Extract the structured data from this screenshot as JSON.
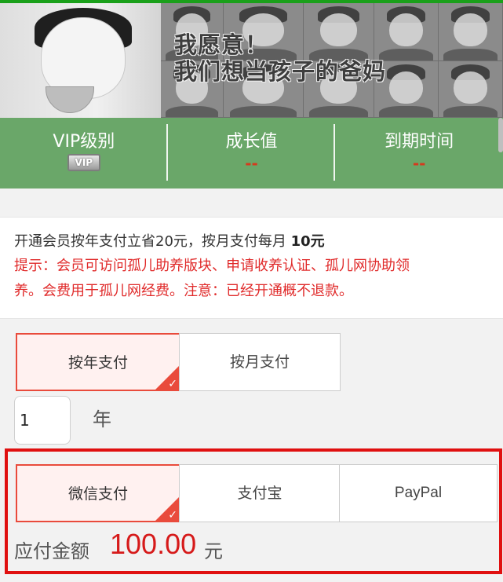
{
  "banner": {
    "slogan_line1": "我愿意！",
    "slogan_line2": "我们想当孩子的爸妈"
  },
  "stats": [
    {
      "label": "VIP级别",
      "badge": "VIP"
    },
    {
      "label": "成长值",
      "value": "--"
    },
    {
      "label": "到期时间",
      "value": "--"
    }
  ],
  "notice": {
    "line1": "开通会员按年支付立省20元，按月支付每月 ",
    "line1_price": "10元",
    "tip_line1": "提示：会员可访问孤儿助养版块、申请收养认证、孤儿网协助领",
    "tip_line2": "养。会费用于孤儿网经费。注意：已经开通概不退款。"
  },
  "billing": {
    "options": [
      "按年支付",
      "按月支付"
    ],
    "selected": "按年支付",
    "quantity": "1",
    "unit": "年"
  },
  "payment": {
    "methods": [
      "微信支付",
      "支付宝",
      "PayPal"
    ],
    "selected": "微信支付",
    "amount_label": "应付金额",
    "amount": "100.00",
    "currency": "元"
  },
  "colors": {
    "top_line": "#1aa01a",
    "stats_bg": "#6aa769",
    "accent": "#e94b3c",
    "highlight_box": "#e01010",
    "amount": "#d61a1a"
  }
}
